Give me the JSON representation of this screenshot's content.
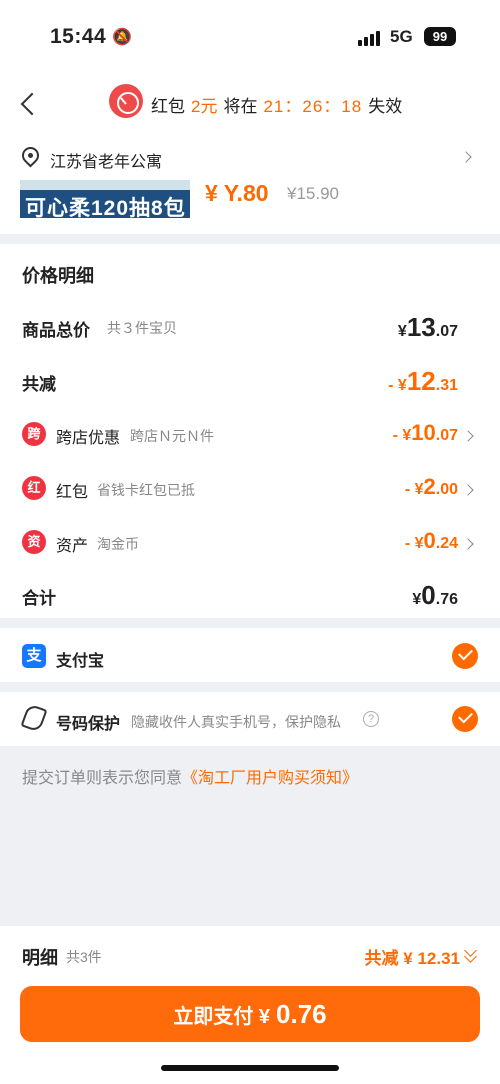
{
  "status_bar": {
    "time": "15:44",
    "network": "5G",
    "battery": "99"
  },
  "header": {
    "redpacket_label": "红包",
    "redpacket_amount": "2元",
    "will_at": "将在",
    "countdown": "21：26：18",
    "expire": "失效"
  },
  "address": {
    "text": "江苏省老年公寓"
  },
  "product": {
    "banner_text": "可心柔120抽8包",
    "price": "¥ Y.80",
    "original_price": "¥15.90"
  },
  "price_detail": {
    "title": "价格明细",
    "goods_total": {
      "label": "商品总价",
      "sub": "共３件宝贝",
      "currency": "¥",
      "int": "13",
      "dec": ".07"
    },
    "total_reduce": {
      "label": "共减",
      "currency": "- ¥",
      "int": "12",
      "dec": ".31"
    },
    "items": [
      {
        "icon": "跨",
        "label": "跨店优惠",
        "sub": "跨店Ｎ元Ｎ件",
        "currency": "- ¥",
        "int": "10",
        "dec": ".07"
      },
      {
        "icon": "红",
        "label": "红包",
        "sub": "省钱卡红包已抵",
        "currency": "- ¥",
        "int": "2",
        "dec": ".00"
      },
      {
        "icon": "资",
        "label": "资产",
        "sub": "淘金币",
        "currency": "- ¥",
        "int": "0",
        "dec": ".24"
      }
    ],
    "total": {
      "label": "合计",
      "currency": "¥",
      "int": "0",
      "dec": ".76"
    }
  },
  "payment": {
    "method": "支付宝",
    "icon_text": "支"
  },
  "protection": {
    "label": "号码保护",
    "sub": "隐藏收件人真实手机号，保护隐私",
    "help": "?"
  },
  "agreement": {
    "text": "提交订单则表示您同意",
    "link": "《淘工厂用户购买须知》"
  },
  "bottom": {
    "detail_label": "明细",
    "count": "共3件",
    "discount": "共减 ¥ 12.31",
    "pay_label": "立即支付 ¥",
    "pay_amount": "0.76"
  },
  "colors": {
    "accent": "#ff6a00",
    "alipay": "#1677ff",
    "red": "#ef3340"
  }
}
